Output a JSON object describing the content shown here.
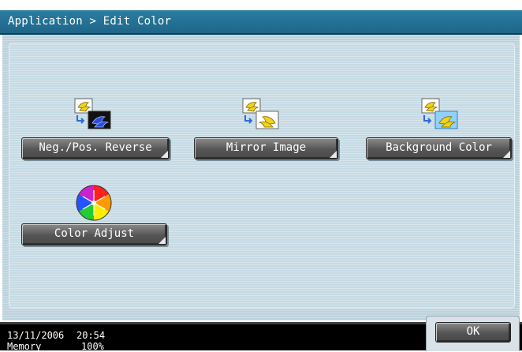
{
  "header": {
    "breadcrumb": "Application > Edit Color"
  },
  "functions": [
    {
      "label": "Neg./Pos. Reverse",
      "icon": "neg-pos-reverse-icon"
    },
    {
      "label": "Mirror Image",
      "icon": "mirror-image-icon"
    },
    {
      "label": "Background Color",
      "icon": "background-color-icon"
    },
    {
      "label": "Color Adjust",
      "icon": "color-wheel-icon"
    }
  ],
  "status": {
    "date": "13/11/2006",
    "time": "20:54",
    "memory_label": "Memory",
    "memory_value": "100%"
  },
  "actions": {
    "ok_label": "OK"
  },
  "colors": {
    "titlebar": "#1f6688",
    "panel": "#bcd2dd",
    "button": "#555555",
    "statusbar": "#000000"
  }
}
